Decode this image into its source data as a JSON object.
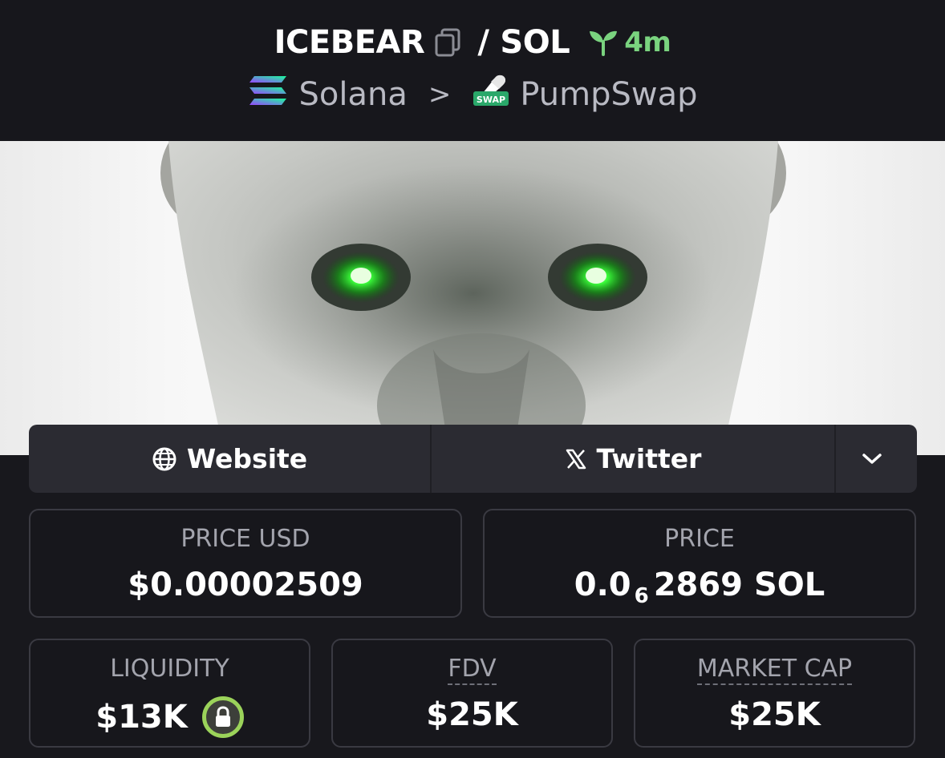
{
  "header": {
    "token": "ICEBEAR",
    "separator": "/",
    "quote": "SOL",
    "age": "4m",
    "chain": "Solana",
    "chevron": ">",
    "dex": "PumpSwap",
    "dex_badge": "SWAP"
  },
  "links": {
    "website": "Website",
    "twitter": "Twitter"
  },
  "stats": {
    "price_usd_label": "PRICE USD",
    "price_usd": "$0.00002509",
    "price_label": "PRICE",
    "price_prefix": "0.0",
    "price_zeros": "6",
    "price_digits": "2869 SOL",
    "liquidity_label": "LIQUIDITY",
    "liquidity": "$13K",
    "fdv_label": "FDV",
    "fdv": "$25K",
    "mcap_label": "MARKET CAP",
    "mcap": "$25K"
  },
  "colors": {
    "age_green": "#7ad37f",
    "lock_ring": "#9bd35a",
    "eye_glow": "#3cff3c"
  }
}
